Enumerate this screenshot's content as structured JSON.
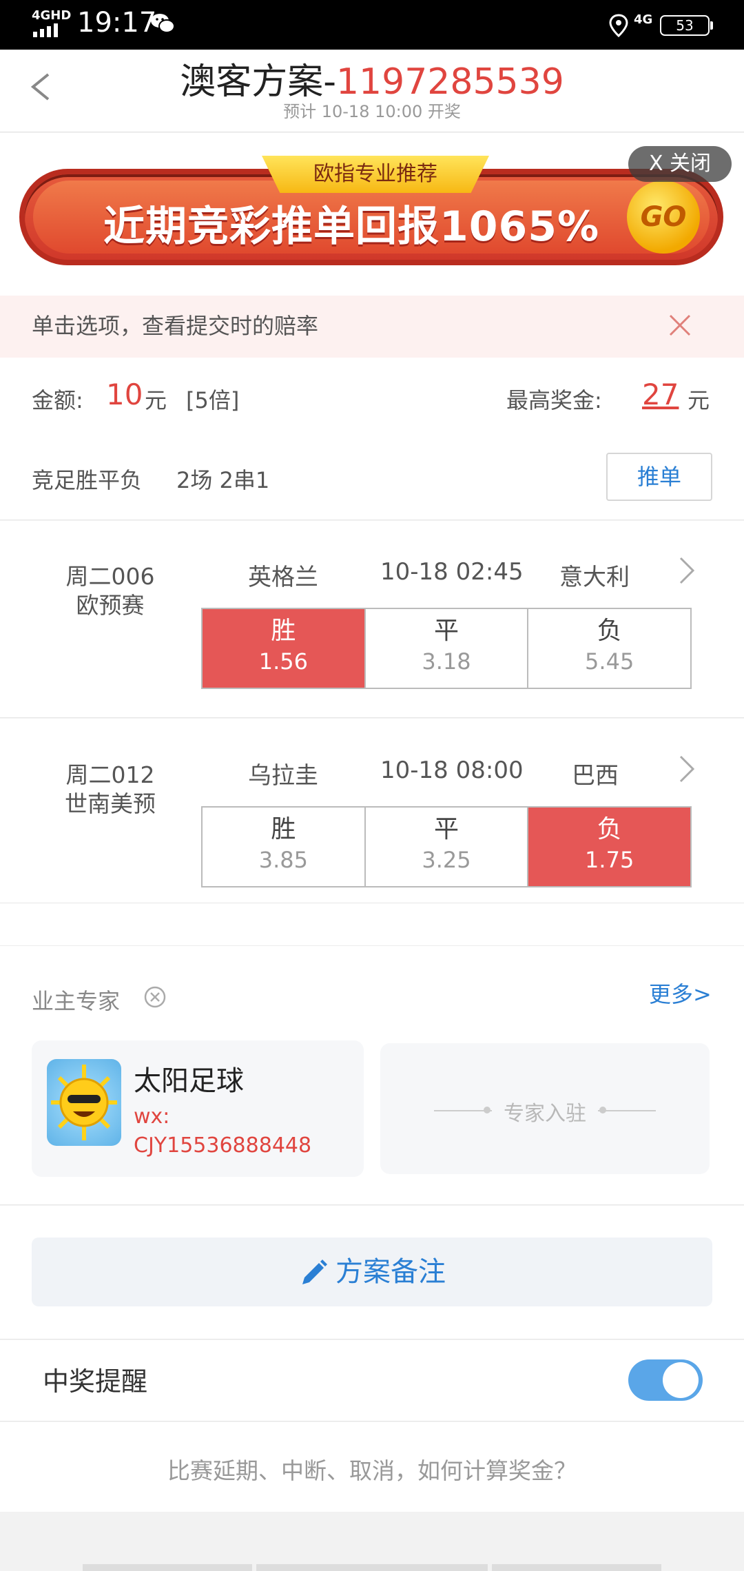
{
  "status": {
    "network": "4GHD",
    "time": "19:17",
    "network2": "4G",
    "battery": "53"
  },
  "header": {
    "title_prefix": "澳客方案-",
    "title_number": "1197285539",
    "subtitle": "预计 10-18 10:00 开奖"
  },
  "ad": {
    "tag": "欧指专业推荐",
    "text": "近期竞彩推单回报1065%",
    "go": "GO",
    "close_label": "X 关闭"
  },
  "tip": {
    "text": "单击选项，查看提交时的赔率"
  },
  "amount": {
    "label": "金额:",
    "value": "10",
    "unit": "元",
    "multiplier": "[5倍]",
    "prize_label": "最高奖金:",
    "prize_value": "27",
    "prize_unit": "元",
    "play_type": "竞足胜平负",
    "play_detail": "2场 2串1",
    "push_button": "推单"
  },
  "matches": [
    {
      "id": "周二006",
      "league": "欧预赛",
      "home": "英格兰",
      "time": "10-18 02:45",
      "away": "意大利",
      "odds": [
        {
          "label": "胜",
          "value": "1.56",
          "selected": true
        },
        {
          "label": "平",
          "value": "3.18",
          "selected": false
        },
        {
          "label": "负",
          "value": "5.45",
          "selected": false
        }
      ]
    },
    {
      "id": "周二012",
      "league": "世南美预",
      "home": "乌拉圭",
      "time": "10-18 08:00",
      "away": "巴西",
      "odds": [
        {
          "label": "胜",
          "value": "3.85",
          "selected": false
        },
        {
          "label": "平",
          "value": "3.25",
          "selected": false
        },
        {
          "label": "负",
          "value": "1.75",
          "selected": true
        }
      ]
    }
  ],
  "experts": {
    "title": "业主专家",
    "more": "更多>",
    "card": {
      "name": "太阳足球",
      "wx_label": "wx:",
      "wx_id": "CJY15536888448"
    },
    "join": "专家入驻"
  },
  "remarks": {
    "label": "方案备注"
  },
  "reminder": {
    "label": "中奖提醒",
    "enabled": true
  },
  "faq": {
    "text": "比赛延期、中断、取消，如何计算奖金？"
  },
  "colors": {
    "accent_red": "#e0453f",
    "selected_bg": "#e55756",
    "link_blue": "#2a7fd4",
    "toggle_on": "#5aa6e8"
  }
}
